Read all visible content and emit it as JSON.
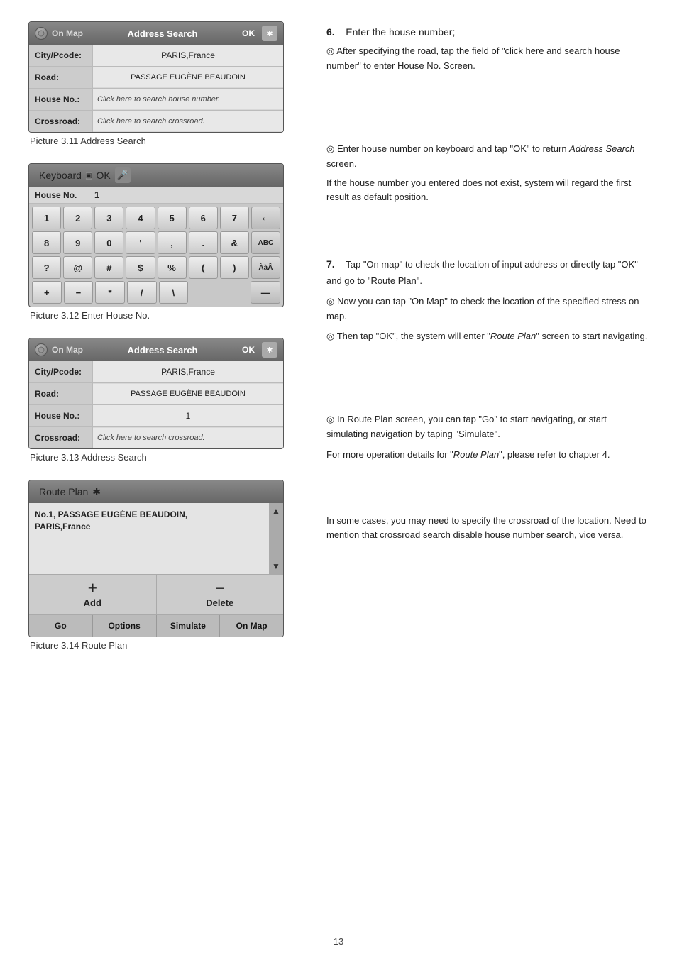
{
  "page": {
    "number": "13"
  },
  "pic311": {
    "caption": "Picture 3.11 Address Search",
    "header": {
      "onmap": "On Map",
      "title": "Address Search",
      "ok": "OK"
    },
    "rows": [
      {
        "label": "City/Pcode:",
        "value": "PARIS,France",
        "clickable": false
      },
      {
        "label": "Road:",
        "value": "PASSAGE EUGÈNE BEAUDOIN",
        "clickable": false
      },
      {
        "label": "House No.:",
        "value": "Click here to search house number.",
        "clickable": true
      },
      {
        "label": "Crossroad:",
        "value": "Click here to search crossroad.",
        "clickable": true
      }
    ]
  },
  "pic312": {
    "caption": "Picture 3.12 Enter House No.",
    "header": {
      "title": "Keyboard",
      "ok": "OK"
    },
    "input": {
      "label": "House No.",
      "value": "1"
    },
    "rows": [
      [
        "1",
        "2",
        "3",
        "4",
        "5",
        "6",
        "7",
        "←"
      ],
      [
        "8",
        "9",
        "0",
        "'",
        ",",
        ".",
        "&",
        "ABC"
      ],
      [
        "?",
        "@",
        "#",
        "$",
        "%",
        "(",
        ")",
        "Ààâ"
      ],
      [
        "+",
        "−",
        "*",
        "/",
        "\\",
        "",
        "",
        "—"
      ]
    ]
  },
  "pic313": {
    "caption": "Picture 3.13 Address Search",
    "header": {
      "onmap": "On Map",
      "title": "Address Search",
      "ok": "OK"
    },
    "rows": [
      {
        "label": "City/Pcode:",
        "value": "PARIS,France",
        "clickable": false
      },
      {
        "label": "Road:",
        "value": "PASSAGE EUGÈNE BEAUDOIN",
        "clickable": false
      },
      {
        "label": "House No.:",
        "value": "1",
        "clickable": false
      },
      {
        "label": "Crossroad:",
        "value": "Click here to search crossroad.",
        "clickable": true
      }
    ]
  },
  "pic314": {
    "caption": "Picture 3.14 Route Plan",
    "header": {
      "title": "Route Plan"
    },
    "route_item": "No.1, PASSAGE EUGÈNE BEAUDOIN,\nPARIS,France",
    "add_label": "Add",
    "delete_label": "Delete",
    "plus_icon": "+",
    "minus_icon": "−",
    "buttons": [
      "Go",
      "Options",
      "Simulate",
      "On Map"
    ]
  },
  "right": {
    "step6_num": "6.",
    "step6_text": "Enter the house number;",
    "step6_note": "After specifying the road, tap the field of \"click here and search house number\" to enter House No. Screen.",
    "keyboard_note1": "Enter house number on keyboard and tap \"OK\" to return Address Search screen.",
    "keyboard_italic": "Address Search",
    "keyboard_note2": "If the house number you entered does not exist, system will regard the first result as default position.",
    "step7_num": "7.",
    "step7_text": "Tap \"On map\" to check the location of input address or directly tap \"OK\" and go to \"Route Plan\".",
    "onmap_note1": "Now you can tap \"On Map\" to check the location of the specified stress on map.",
    "onmap_note2": "Then tap \"OK\", the system will enter \"Route Plan\" screen to start navigating.",
    "onmap_italic": "Route Plan",
    "routeplan_note1": "In Route Plan screen, you can tap \"Go\" to start navigating, or start simulating navigation by taping \"Simulate\".",
    "routeplan_note2": "For more operation details for \"Route Plan\", please refer to chapter 4.",
    "routeplan_italic": "Route Plan",
    "crossroad_note": "In some cases, you may need to specify the crossroad of the location. Need to mention that crossroad search disable house number search, vice versa."
  }
}
